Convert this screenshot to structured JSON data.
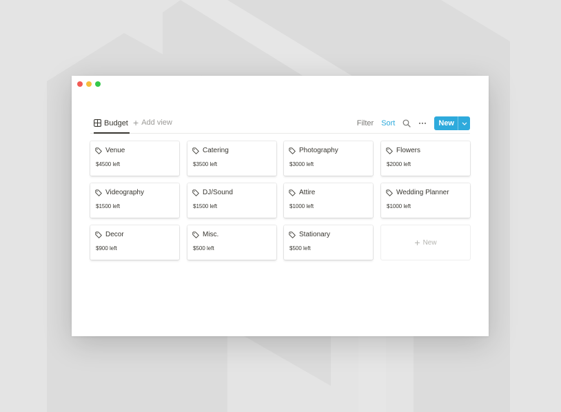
{
  "view": {
    "tab_label": "Budget",
    "add_view_label": "Add view"
  },
  "toolbar": {
    "filter_label": "Filter",
    "sort_label": "Sort",
    "new_label": "New"
  },
  "cards": [
    {
      "title": "Venue",
      "amount": "$4500 left"
    },
    {
      "title": "Catering",
      "amount": "$3500 left"
    },
    {
      "title": "Photography",
      "amount": "$3000 left"
    },
    {
      "title": "Flowers",
      "amount": "$2000 left"
    },
    {
      "title": "Videography",
      "amount": "$1500 left"
    },
    {
      "title": "DJ/Sound",
      "amount": "$1500 left"
    },
    {
      "title": "Attire",
      "amount": "$1000 left"
    },
    {
      "title": "Wedding Planner",
      "amount": "$1000 left"
    },
    {
      "title": "Decor",
      "amount": "$900 left"
    },
    {
      "title": "Misc.",
      "amount": "$500 left"
    },
    {
      "title": "Stationary",
      "amount": "$500 left"
    }
  ],
  "new_card_label": "New",
  "colors": {
    "accent": "#2eaadc",
    "background": "#e4e4e4",
    "window": "#ffffff"
  },
  "icons": {
    "view": "table-icon",
    "card": "tag-icon",
    "search": "search-icon",
    "more": "more-icon"
  }
}
